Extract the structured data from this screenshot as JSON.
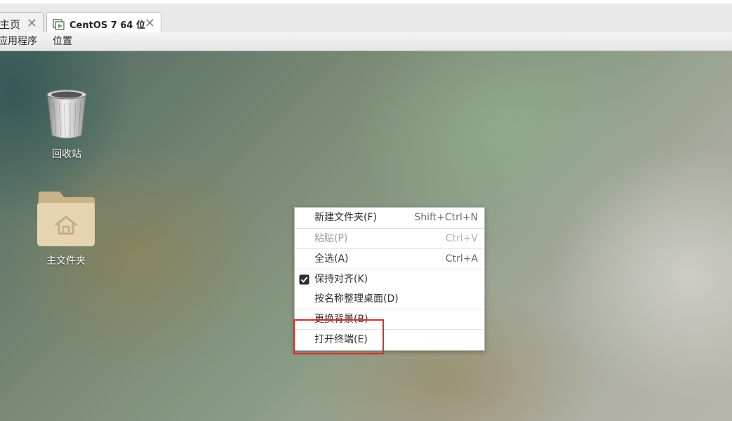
{
  "tabs": [
    {
      "label": "主页",
      "close": "✕"
    },
    {
      "label": "CentOS 7 64 位",
      "close": "✕"
    }
  ],
  "panel": {
    "applications": "应用程序",
    "places": "位置"
  },
  "desktop": {
    "icons": [
      {
        "label": "回收站",
        "icon": "trash-icon"
      },
      {
        "label": "主文件夹",
        "icon": "home-folder-icon"
      }
    ]
  },
  "context_menu": {
    "items": [
      {
        "label": "新建文件夹(F)",
        "accel": "Shift+Ctrl+N",
        "disabled": false
      },
      {
        "label": "粘贴(P)",
        "accel": "Ctrl+V",
        "disabled": true
      },
      {
        "label": "全选(A)",
        "accel": "Ctrl+A",
        "disabled": false
      },
      {
        "label": "保持对齐(K)",
        "accel": "",
        "checked": true
      },
      {
        "label": "按名称整理桌面(D)",
        "accel": ""
      },
      {
        "label": "更换背景(B)",
        "accel": ""
      },
      {
        "label": "打开终端(E)",
        "accel": ""
      }
    ]
  },
  "colors": {
    "highlight_border": "#e02a2a",
    "vm_tab_accent": "#4caf50"
  }
}
